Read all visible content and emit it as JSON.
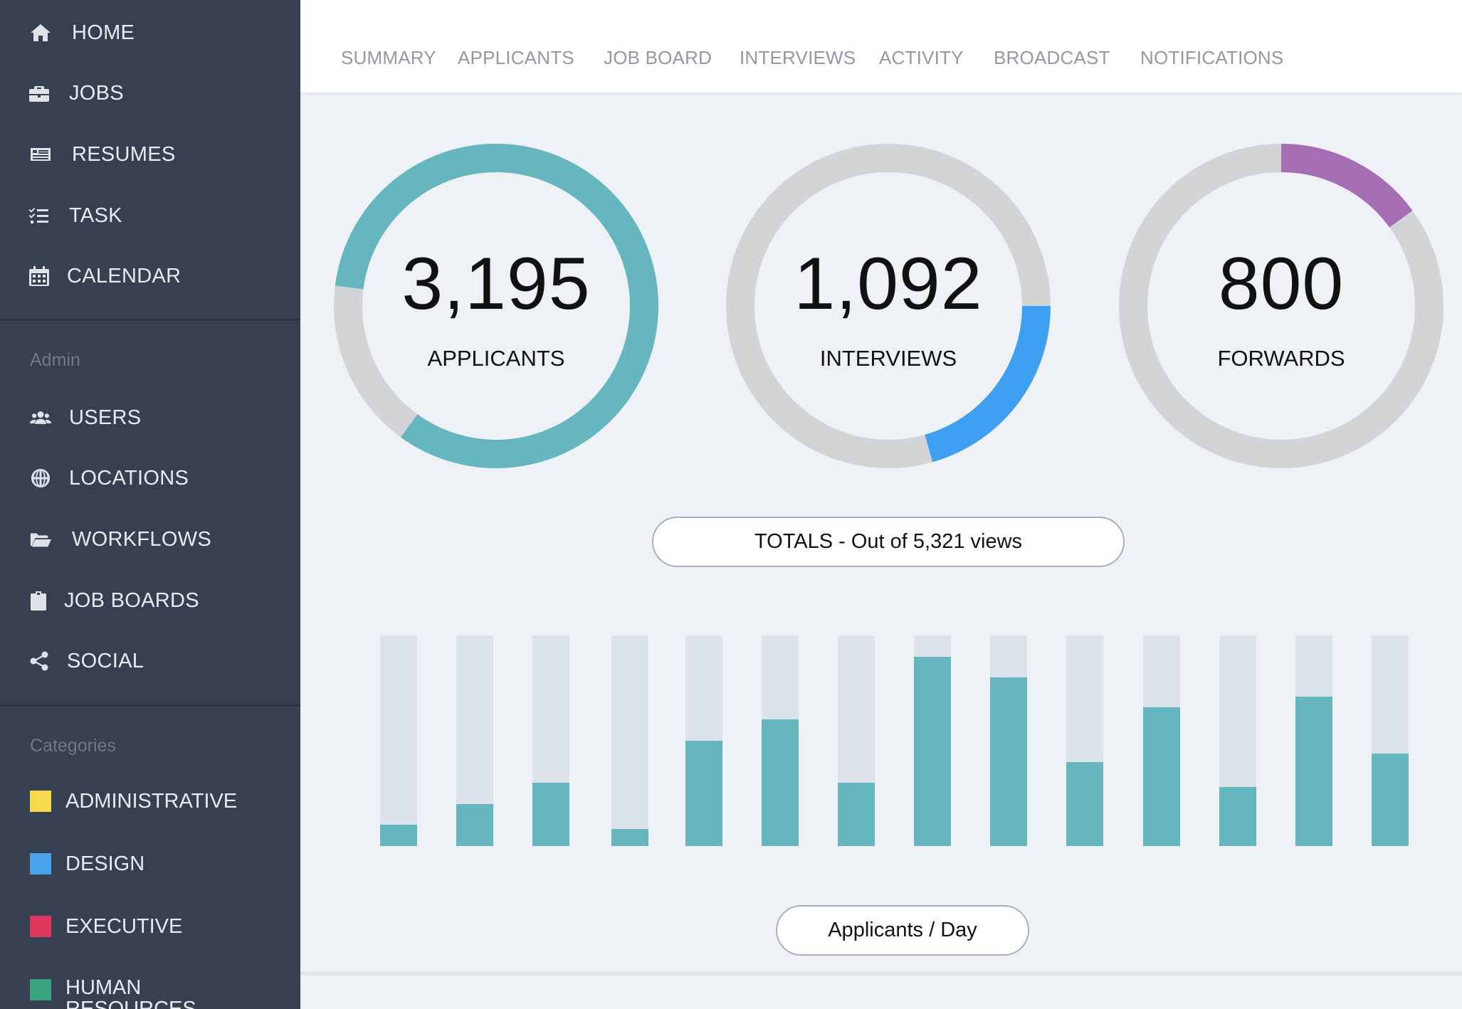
{
  "sidebar": {
    "main_items": [
      {
        "label": "HOME",
        "icon": "home-icon"
      },
      {
        "label": "JOBS",
        "icon": "briefcase-icon"
      },
      {
        "label": "RESUMES",
        "icon": "resume-icon"
      },
      {
        "label": "TASK",
        "icon": "task-list-icon"
      },
      {
        "label": "CALENDAR",
        "icon": "calendar-icon"
      }
    ],
    "admin_title": "Admin",
    "admin_items": [
      {
        "label": "USERS",
        "icon": "users-icon"
      },
      {
        "label": "LOCATIONS",
        "icon": "globe-icon"
      },
      {
        "label": "WORKFLOWS",
        "icon": "folder-open-icon"
      },
      {
        "label": "JOB BOARDS",
        "icon": "clipboard-icon"
      },
      {
        "label": "SOCIAL",
        "icon": "share-icon"
      }
    ],
    "categories_title": "Categories",
    "categories": [
      {
        "label": "ADMINISTRATIVE",
        "color": "#f7d94c"
      },
      {
        "label": "DESIGN",
        "color": "#4aa3ea"
      },
      {
        "label": "EXECUTIVE",
        "color": "#e0375f"
      },
      {
        "label": "HUMAN RESOURCES",
        "color": "#3aa57f"
      }
    ]
  },
  "tabs": [
    "SUMMARY",
    "APPLICANTS",
    "JOB BOARD",
    "INTERVIEWS",
    "ACTIVITY",
    "BROADCAST",
    "NOTIFICATIONS"
  ],
  "stats": [
    {
      "value": "3,195",
      "label": "APPLICANTS",
      "color": "#66b6bf",
      "start_fraction": 0.77,
      "end_fraction": 0.6
    },
    {
      "value": "1,092",
      "label": "INTERVIEWS",
      "color": "#3f9ff0",
      "start_fraction": 0.25,
      "end_fraction": 0.456
    },
    {
      "value": "800",
      "label": "FORWARDS",
      "color": "#a56db4",
      "start_fraction": 0.0,
      "end_fraction": 0.15
    }
  ],
  "totals_label": "TOTALS - Out of 5,321 views",
  "chart_label": "Applicants / Day",
  "chart_data": {
    "type": "bar",
    "categories": [
      "",
      "",
      "",
      "",
      "",
      "",
      "",
      "",
      "",
      "",
      "",
      "",
      "",
      ""
    ],
    "values": [
      10,
      20,
      30,
      8,
      50,
      60,
      30,
      90,
      80,
      40,
      66,
      28,
      71,
      44
    ],
    "ylim": [
      0,
      100
    ],
    "series_color": "#66b6bf",
    "track_color": "#dde3ea"
  }
}
